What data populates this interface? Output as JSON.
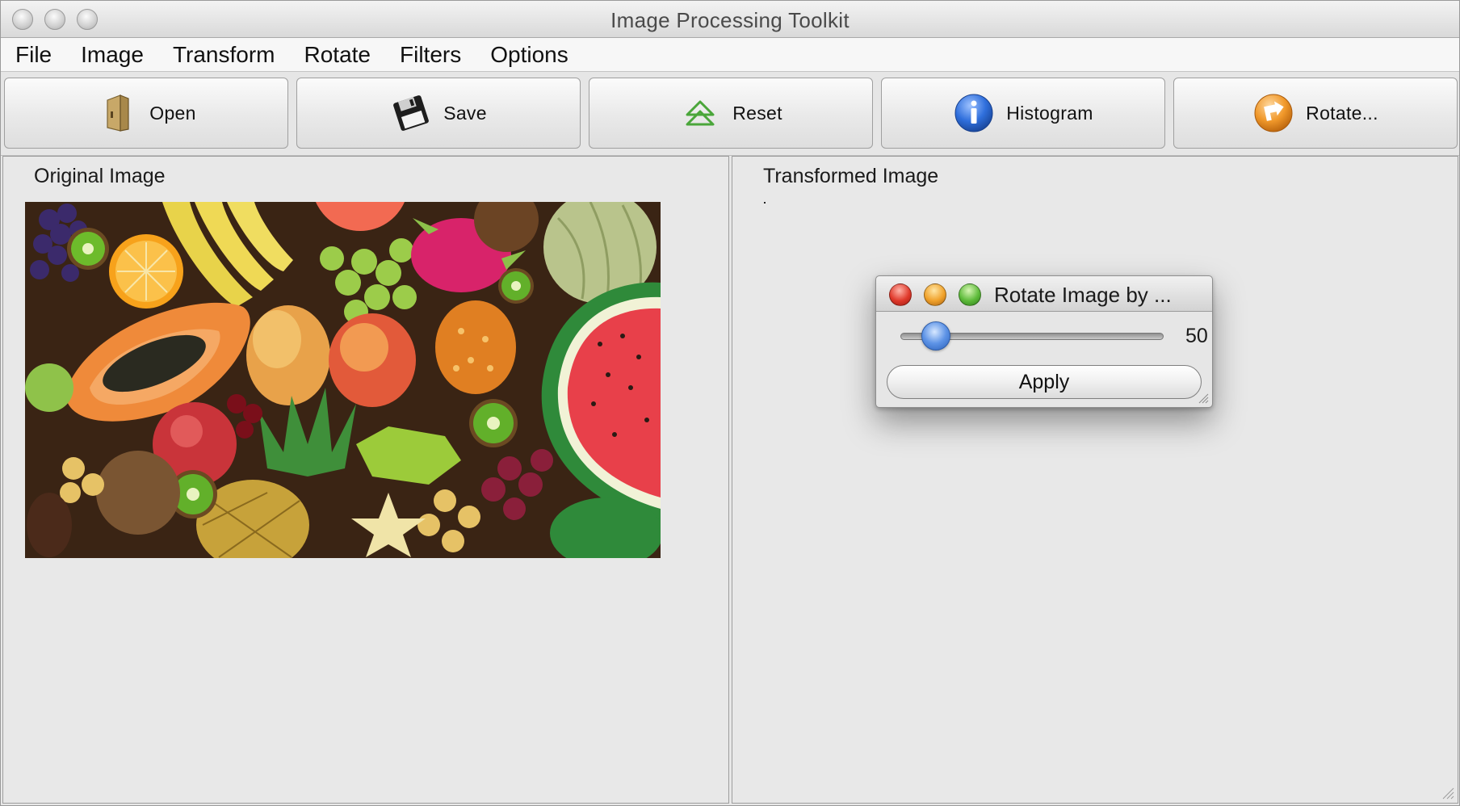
{
  "window": {
    "title": "Image Processing Toolkit"
  },
  "menubar": {
    "items": [
      "File",
      "Image",
      "Transform",
      "Rotate",
      "Filters",
      "Options"
    ]
  },
  "toolbar": {
    "buttons": [
      {
        "label": "Open",
        "icon": "folder-icon"
      },
      {
        "label": "Save",
        "icon": "floppy-disk-icon"
      },
      {
        "label": "Reset",
        "icon": "reset-triangle-icon"
      },
      {
        "label": "Histogram",
        "icon": "info-icon"
      },
      {
        "label": "Rotate...",
        "icon": "rotate-arrow-icon"
      }
    ]
  },
  "panels": {
    "original": {
      "title": "Original Image",
      "image": "photo of assorted tropical fruits"
    },
    "transformed": {
      "title": "Transformed Image"
    }
  },
  "dialog": {
    "title": "Rotate Image by ...",
    "slider_value": "50",
    "slider_fraction": 0.1,
    "apply_label": "Apply"
  },
  "colors": {
    "accent_blue": "#3b7be0",
    "close_red": "#e0392b",
    "minimize_yellow": "#f0a12a",
    "zoom_green": "#5dbb3a"
  }
}
